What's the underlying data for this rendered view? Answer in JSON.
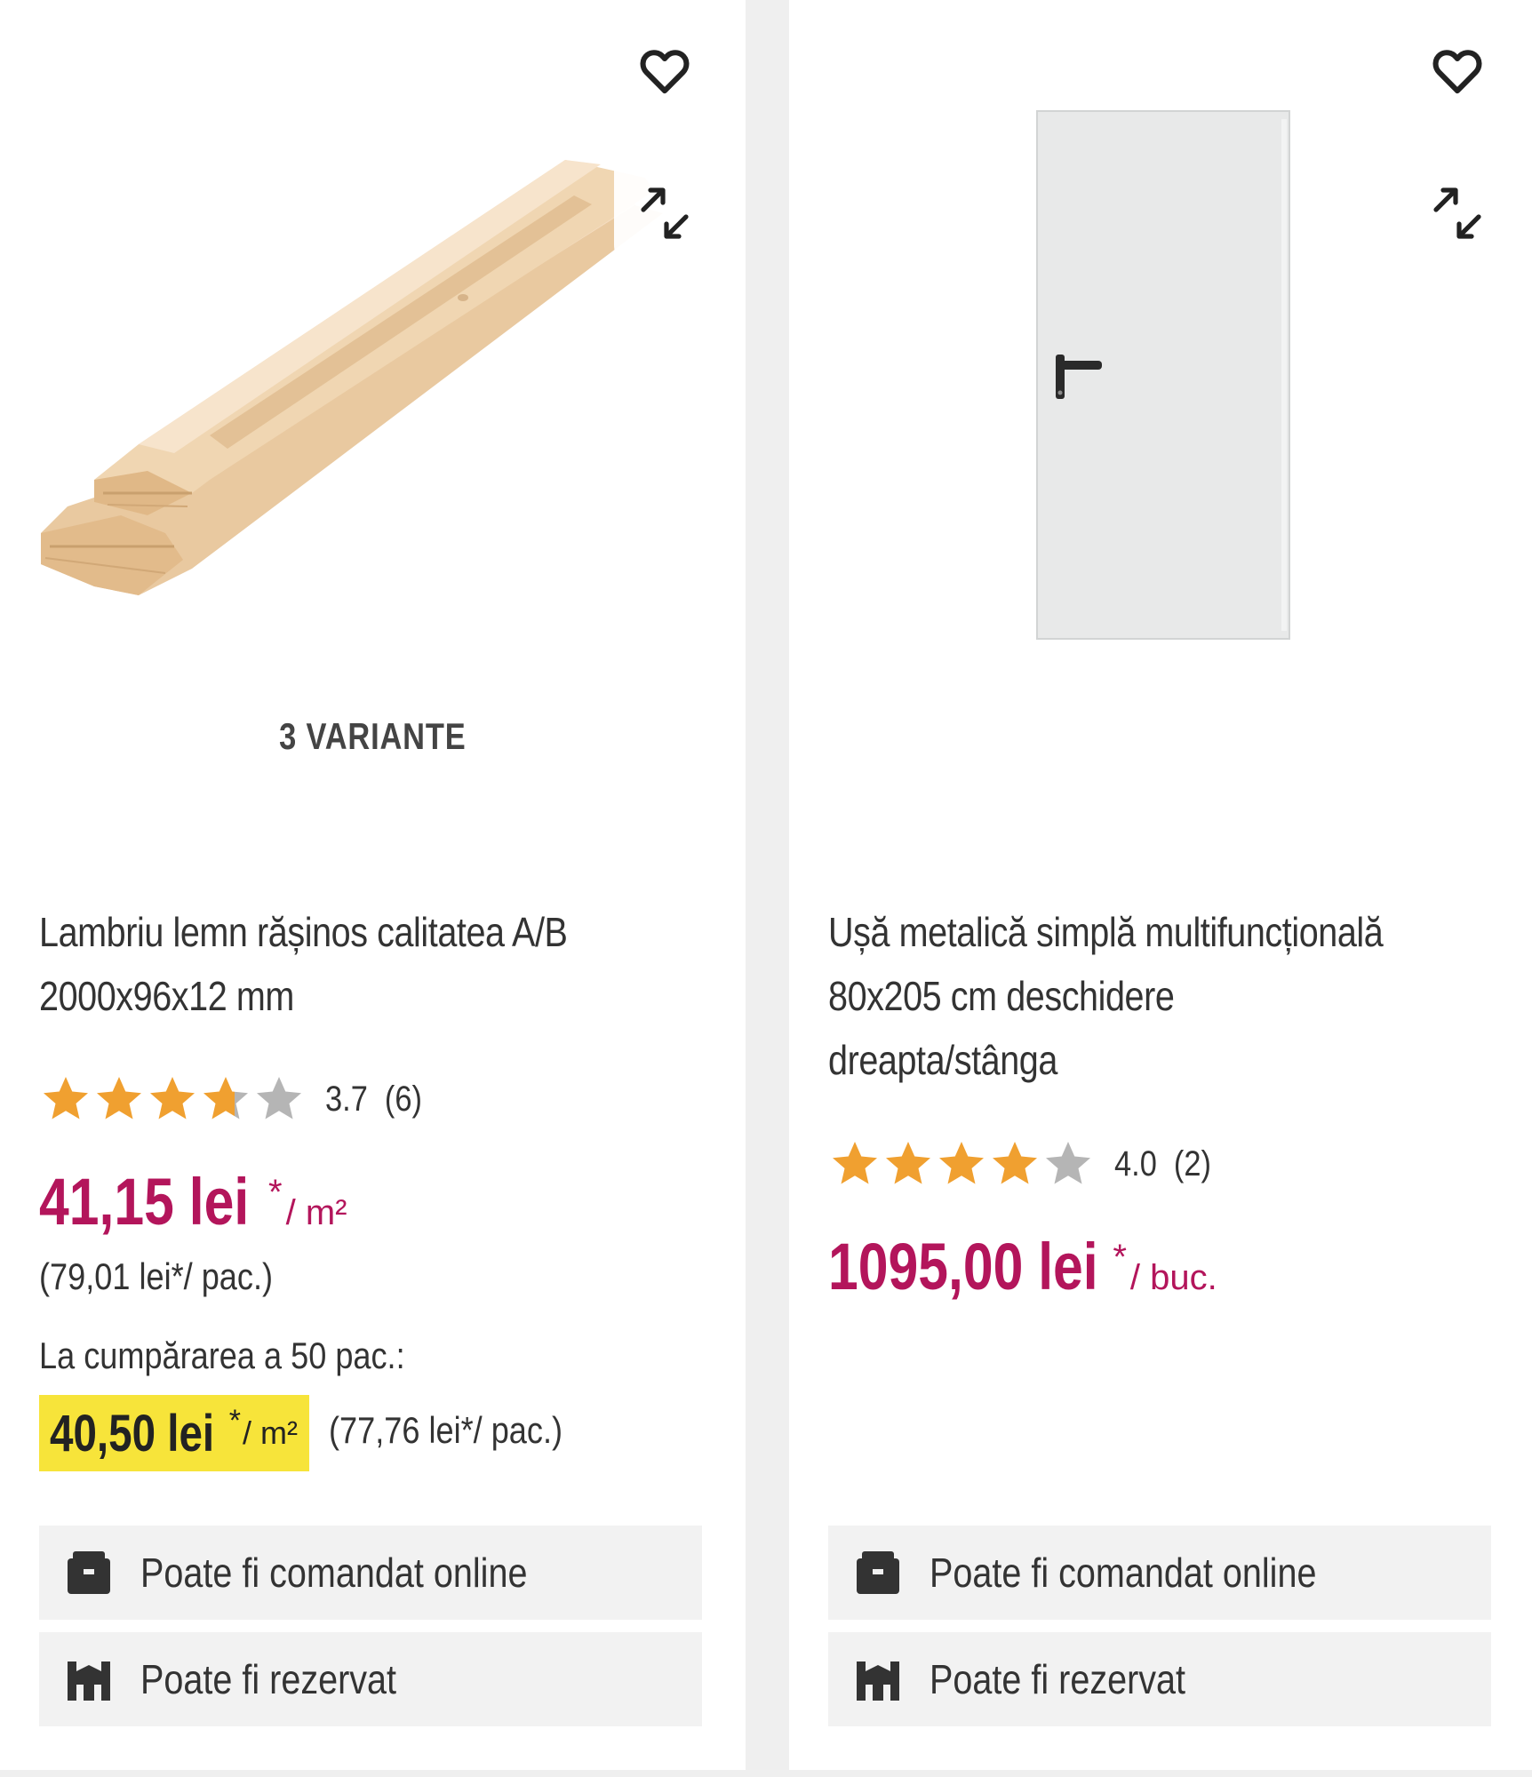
{
  "products": [
    {
      "variants_label": "3 VARIANTE",
      "title_line1": "Lambriu lemn rășinos calitatea A/B",
      "title_line2": "2000x96x12 mm",
      "rating_value": 3.7,
      "rating_text": "3.7  (6)",
      "price": "41,15 lei",
      "price_star": "*",
      "price_unit": "/ m²",
      "pack_price": "(79,01 lei*/ pac.)",
      "bulk_label": "La cumpărarea a 50 pac.:",
      "bulk_price": "40,50 lei",
      "bulk_unit": "/ m²",
      "bulk_pack_price": "(77,76 lei*/ pac.)",
      "availability": [
        "Poate fi comandat online",
        "Poate fi rezervat"
      ]
    },
    {
      "title_line1": "Ușă metalică simplă multifuncțională",
      "title_line2": "80x205 cm deschidere",
      "title_line3": "dreapta/stânga",
      "rating_value": 4.0,
      "rating_text": "4.0  (2)",
      "price": "1095,00 lei",
      "price_star": "*",
      "price_unit": "/ buc.",
      "availability": [
        "Poate fi comandat online",
        "Poate fi rezervat"
      ]
    }
  ],
  "icons": {
    "favorite": "heart-icon",
    "compare": "compare-arrows-icon",
    "online": "package-icon",
    "reserve": "store-icon"
  },
  "colors": {
    "price": "#b3155b",
    "star_filled": "#f0a030",
    "star_empty": "#b5b5b5",
    "promo_bg": "#f7e43a"
  }
}
